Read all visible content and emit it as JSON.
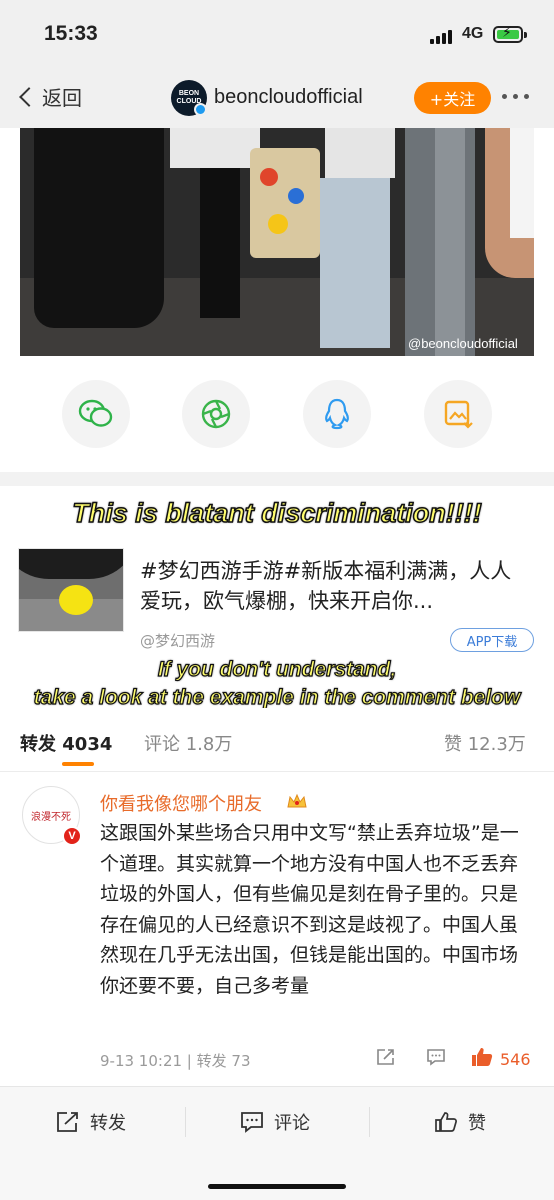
{
  "status_bar": {
    "time": "15:33",
    "network": "4G"
  },
  "nav": {
    "back_label": "返回",
    "avatar_text": "BEON CLOUD",
    "account_name": "beoncloudofficial",
    "follow_label": "+关注"
  },
  "photo": {
    "watermark": "@beoncloudofficial"
  },
  "share_icons": [
    "wechat-icon",
    "moments-icon",
    "qq-icon",
    "save-image-icon"
  ],
  "overlay": {
    "caption_top": "This is blatant discrimination!!!!",
    "caption_bottom_line1": "If you don't understand,",
    "caption_bottom_line2": "take a look at the example in the comment below"
  },
  "ad": {
    "title": "#梦幻西游手游#新版本福利满满，人人爱玩，欧气爆棚，快来开启你...",
    "source": "@梦幻西游",
    "button": "APP下载"
  },
  "tabs": {
    "repost": "转发 4034",
    "comment": "评论 1.8万",
    "likes": "赞 12.3万"
  },
  "comment": {
    "avatar_text": "浪漫不死",
    "badge": "V",
    "username": "你看我像您哪个朋友",
    "text": "这跟国外某些场合只用中文写“禁止丢弃垃圾”是一个道理。其实就算一个地方没有中国人也不乏丢弃垃圾的外国人，但有些偏见是刻在骨子里的。只是存在偏见的人已经意识不到这是歧视了。中国人虽然现在几乎无法出国，但钱是能出国的。中国市场你还要不要，自己多考量",
    "meta": "9-13 10:21 | 转发 73",
    "like_count": "546",
    "colors": {
      "name": "#e86b2a",
      "like": "#ea5d2a"
    }
  },
  "toolbar": {
    "repost": "转发",
    "comment": "评论",
    "like": "赞"
  },
  "colors": {
    "accent": "#ff8200",
    "link": "#3b7cd8"
  }
}
